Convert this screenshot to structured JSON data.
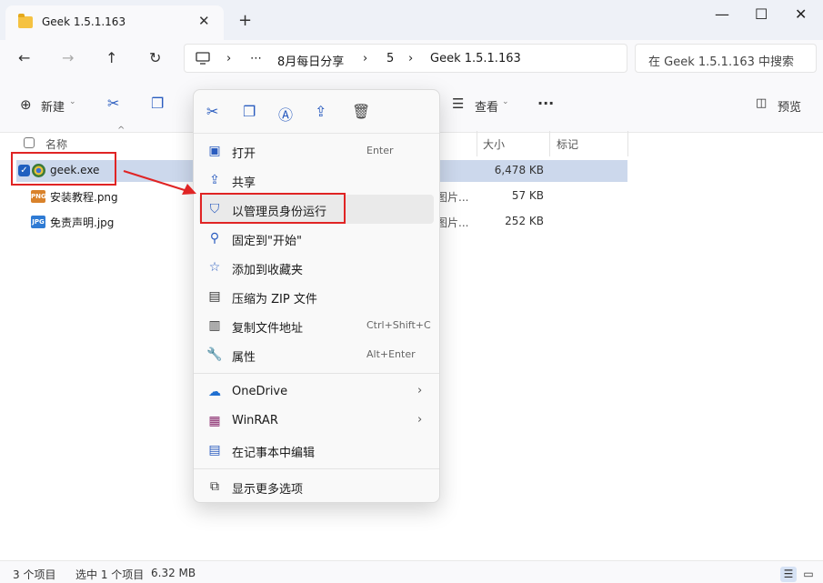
{
  "window": {
    "tab_title": "Geek 1.5.1.163",
    "tab_close": "✕",
    "new_tab": "+",
    "minimize": "—",
    "maximize": "☐",
    "close": "✕"
  },
  "nav": {
    "back": "←",
    "forward": "→",
    "up": "↑",
    "refresh": "↻"
  },
  "address": {
    "ellipsis": "⋯",
    "segments": [
      "8月每日分享",
      "5",
      "Geek 1.5.1.163"
    ],
    "chevron": "›"
  },
  "search": {
    "placeholder": "在 Geek 1.5.1.163 中搜索"
  },
  "toolbar": {
    "new_label": "新建",
    "view_label": "查看",
    "preview_label": "预览",
    "more": "···"
  },
  "columns": {
    "name": "名称",
    "size": "大小",
    "tag": "标记"
  },
  "files": [
    {
      "name": "geek.exe",
      "type": "",
      "size": "6,478 KB",
      "badge": ""
    },
    {
      "name": "安装教程.png",
      "type": "图片...",
      "size": "57 KB",
      "badge": "PNG"
    },
    {
      "name": "免责声明.jpg",
      "type": "图片...",
      "size": "252 KB",
      "badge": "JPG"
    }
  ],
  "context_menu": {
    "quick_actions": [
      "cut-icon",
      "copy-icon",
      "rename-icon",
      "share-icon",
      "delete-icon"
    ],
    "items": [
      {
        "label": "打开",
        "shortcut": "Enter"
      },
      {
        "label": "共享",
        "shortcut": ""
      },
      {
        "label": "以管理员身份运行",
        "shortcut": ""
      },
      {
        "label": "固定到\"开始\"",
        "shortcut": ""
      },
      {
        "label": "添加到收藏夹",
        "shortcut": ""
      },
      {
        "label": "压缩为 ZIP 文件",
        "shortcut": ""
      },
      {
        "label": "复制文件地址",
        "shortcut": "Ctrl+Shift+C"
      },
      {
        "label": "属性",
        "shortcut": "Alt+Enter"
      },
      {
        "label": "OneDrive",
        "shortcut": ""
      },
      {
        "label": "WinRAR",
        "shortcut": ""
      },
      {
        "label": "在记事本中编辑",
        "shortcut": ""
      },
      {
        "label": "显示更多选项",
        "shortcut": ""
      }
    ]
  },
  "status": {
    "item_count": "3 个项目",
    "selection": "选中 1 个项目",
    "selection_size": "6.32 MB"
  },
  "colors": {
    "accent": "#2a5cbf",
    "highlight": "#e02424",
    "selection": "#ccd8ec"
  }
}
